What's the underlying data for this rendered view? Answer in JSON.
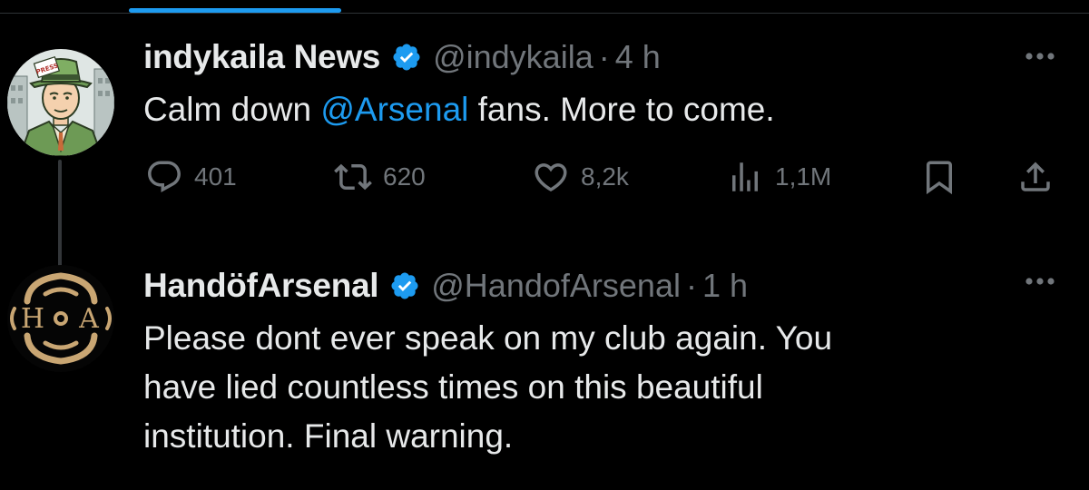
{
  "tweets": [
    {
      "display_name": "indykaila News",
      "handle": "@indykaila",
      "separator": "·",
      "time": "4 h",
      "text_before": "Calm down ",
      "mention": "@Arsenal",
      "text_after": " fans. More to come.",
      "stats": {
        "replies": "401",
        "reposts": "620",
        "likes": "8,2k",
        "views": "1,1M"
      },
      "avatar_badge": "PRESS"
    },
    {
      "display_name": "HandöfArsenal",
      "handle": "@HandofArsenal",
      "separator": "·",
      "time": "1 h",
      "text_line_1": "Please dont ever speak on my club again. You",
      "text_line_2": "have lied countless times on this beautiful",
      "text_line_3": "institution. Final warning.",
      "avatar_left": "H",
      "avatar_right": "A"
    }
  ],
  "colors": {
    "background": "#000000",
    "text": "#e7e9ea",
    "secondary": "#71767b",
    "accent": "#1d9bf0",
    "thread_line": "#333639",
    "logo_gold": "#c9a673"
  },
  "icons": [
    "verified-badge-icon",
    "more-icon",
    "reply-icon",
    "repost-icon",
    "like-icon",
    "views-icon",
    "bookmark-icon",
    "share-icon"
  ]
}
